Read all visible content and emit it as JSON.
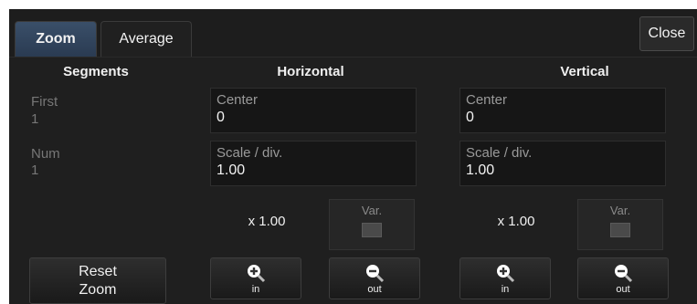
{
  "tabs": [
    {
      "label": "Zoom",
      "active": true
    },
    {
      "label": "Average",
      "active": false
    }
  ],
  "close_label": "Close",
  "segments": {
    "header": "Segments",
    "first_label": "First",
    "first_value": "1",
    "num_label": "Num",
    "num_value": "1",
    "reset_label_line1": "Reset",
    "reset_label_line2": "Zoom"
  },
  "horizontal": {
    "header": "Horizontal",
    "center_label": "Center",
    "center_value": "0",
    "scale_label": "Scale / div.",
    "scale_value": "1.00",
    "multiplier": "x 1.00",
    "var_label": "Var.",
    "zoom_in_label": "in",
    "zoom_out_label": "out"
  },
  "vertical": {
    "header": "Vertical",
    "center_label": "Center",
    "center_value": "0",
    "scale_label": "Scale / div.",
    "scale_value": "1.00",
    "multiplier": "x 1.00",
    "var_label": "Var.",
    "zoom_in_label": "in",
    "zoom_out_label": "out"
  },
  "icons": {
    "zoom_in": "zoom-in-icon",
    "zoom_out": "zoom-out-icon"
  },
  "colors": {
    "panel_bg": "#1f1f1f",
    "active_tab": "#3a4f69",
    "field_bg": "#161616"
  }
}
